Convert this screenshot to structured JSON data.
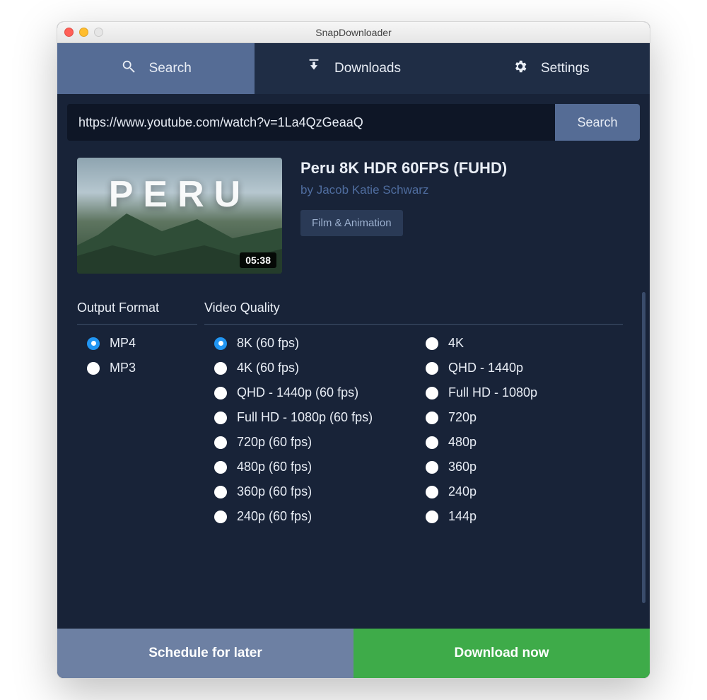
{
  "window": {
    "title": "SnapDownloader"
  },
  "tabs": {
    "search": "Search",
    "downloads": "Downloads",
    "settings": "Settings"
  },
  "searchbar": {
    "value": "https://www.youtube.com/watch?v=1La4QzGeaaQ",
    "button": "Search"
  },
  "video": {
    "title": "Peru 8K HDR 60FPS (FUHD)",
    "author_prefix": "by ",
    "author": "Jacob Katie Schwarz",
    "category": "Film & Animation",
    "duration": "05:38",
    "thumb_text": "PERU"
  },
  "format": {
    "heading": "Output Format",
    "options": [
      "MP4",
      "MP3"
    ],
    "selected": "MP4"
  },
  "quality": {
    "heading": "Video Quality",
    "col1": [
      "8K (60 fps)",
      "4K (60 fps)",
      "QHD - 1440p (60 fps)",
      "Full HD - 1080p (60 fps)",
      "720p (60 fps)",
      "480p (60 fps)",
      "360p (60 fps)",
      "240p (60 fps)"
    ],
    "col2": [
      "4K",
      "QHD - 1440p",
      "Full HD - 1080p",
      "720p",
      "480p",
      "360p",
      "240p",
      "144p"
    ],
    "selected": "8K (60 fps)"
  },
  "actions": {
    "schedule": "Schedule for later",
    "download": "Download now"
  }
}
